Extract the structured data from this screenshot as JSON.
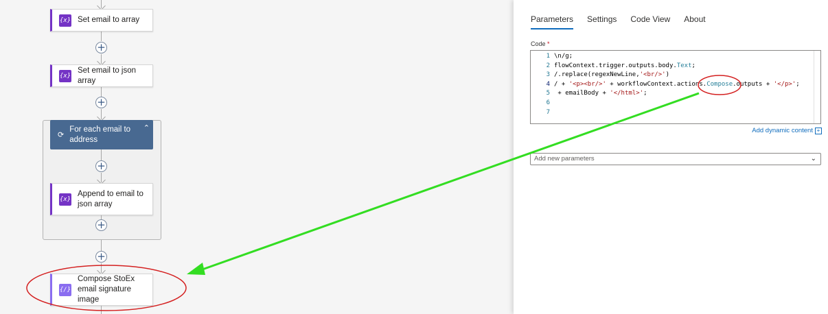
{
  "designer": {
    "actions": [
      {
        "label": "Set email to array",
        "icon": "variable-icon"
      },
      {
        "label": "Set email to json array",
        "icon": "variable-icon"
      },
      {
        "label": "Append to email to json array",
        "icon": "variable-icon"
      },
      {
        "label": "Compose StoEx email signature image",
        "icon": "compose-icon"
      }
    ],
    "foreach": {
      "label": "For each email to address",
      "icon": "loop-icon",
      "collapse_icon": "chevron-up-icon"
    },
    "icon_glyphs": {
      "variable": "{x}",
      "compose": "{/}",
      "loop": "⟳",
      "plus": "+",
      "chevron_up": "⌃"
    }
  },
  "panel": {
    "tabs": [
      "Parameters",
      "Settings",
      "Code View",
      "About"
    ],
    "active_tab": "Parameters",
    "code_label": "Code",
    "required_mark": "*",
    "code_lines": [
      {
        "num": "1",
        "tokens": [
          {
            "t": "\\n/g;",
            "c": "plain"
          }
        ]
      },
      {
        "num": "2",
        "tokens": [
          {
            "t": "flowContext.trigger.outputs.body.",
            "c": "plain"
          },
          {
            "t": "Text",
            "c": "prop"
          },
          {
            "t": ";",
            "c": "plain"
          }
        ]
      },
      {
        "num": "3",
        "tokens": [
          {
            "t": "/.replace(regexNewLine,",
            "c": "plain"
          },
          {
            "t": "'<br/>'",
            "c": "str"
          },
          {
            "t": ")",
            "c": "plain"
          }
        ]
      },
      {
        "num": "4",
        "tokens": [
          {
            "t": "/ + ",
            "c": "plain"
          },
          {
            "t": "'<p><br/>'",
            "c": "str"
          },
          {
            "t": " + workflowContext.actions.",
            "c": "plain"
          },
          {
            "t": "Compose",
            "c": "prop"
          },
          {
            "t": ".outputs + ",
            "c": "plain"
          },
          {
            "t": "'</p>'",
            "c": "str"
          },
          {
            "t": ";",
            "c": "plain"
          }
        ]
      },
      {
        "num": "5",
        "tokens": [
          {
            "t": " + emailBody + ",
            "c": "plain"
          },
          {
            "t": "'</html>'",
            "c": "str"
          },
          {
            "t": ";",
            "c": "plain"
          }
        ]
      },
      {
        "num": "6",
        "tokens": []
      },
      {
        "num": "7",
        "tokens": []
      }
    ],
    "dynamic_content_label": "Add dynamic content",
    "add_params_placeholder": "Add new parameters",
    "colors": {
      "accent": "#0f6cbd",
      "variable": "#7433c5",
      "compose": "#8a6df0",
      "foreach": "#486991",
      "annotation_arrow": "#33dd22",
      "annotation_circle": "#d42020"
    }
  }
}
